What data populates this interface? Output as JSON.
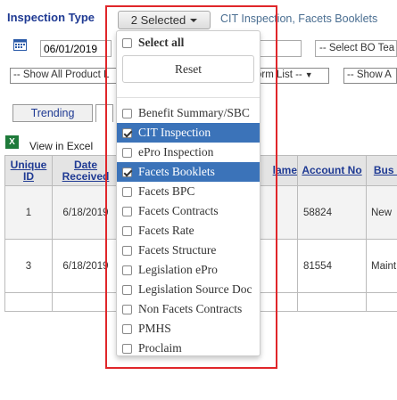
{
  "header": {
    "inspection_type_label": "Inspection Type",
    "selected_button_label": "2 Selected",
    "selected_summary": "CIT Inspection, Facets Booklets"
  },
  "filters": {
    "date_value": "06/01/2019",
    "bo_select_label": "-- Select BO Tea",
    "product_select_label": "-- Show All Product L",
    "form_select_label": "orm List --",
    "show_all_label": "-- Show A"
  },
  "tabs": {
    "trending": "Trending",
    "second": "A"
  },
  "export": {
    "view_in_excel": "View in Excel"
  },
  "table": {
    "columns": [
      "Unique ID",
      "Date Received",
      "",
      "",
      "lame",
      "Account No",
      "Bus T"
    ],
    "rows": [
      {
        "id": "1",
        "date": "6/18/2019",
        "account": "58824",
        "bus": "New"
      },
      {
        "id": "3",
        "date": "6/18/2019",
        "account": "81554",
        "bus": "Maint"
      }
    ]
  },
  "dropdown": {
    "select_all": "Select all",
    "reset": "Reset",
    "options": [
      {
        "label": "Benefit Summary/SBC",
        "checked": false
      },
      {
        "label": "CIT Inspection",
        "checked": true
      },
      {
        "label": "ePro Inspection",
        "checked": false
      },
      {
        "label": "Facets Booklets",
        "checked": true
      },
      {
        "label": "Facets BPC",
        "checked": false
      },
      {
        "label": "Facets Contracts",
        "checked": false
      },
      {
        "label": "Facets Rate",
        "checked": false
      },
      {
        "label": "Facets Structure",
        "checked": false
      },
      {
        "label": "Legislation ePro",
        "checked": false
      },
      {
        "label": "Legislation Source Doc",
        "checked": false
      },
      {
        "label": "Non Facets Contracts",
        "checked": false
      },
      {
        "label": "PMHS",
        "checked": false
      },
      {
        "label": "Proclaim",
        "checked": false
      }
    ]
  },
  "colors": {
    "accent": "#3b73b9",
    "highlight_border": "#e0262a",
    "label_blue": "#1f3a93"
  }
}
